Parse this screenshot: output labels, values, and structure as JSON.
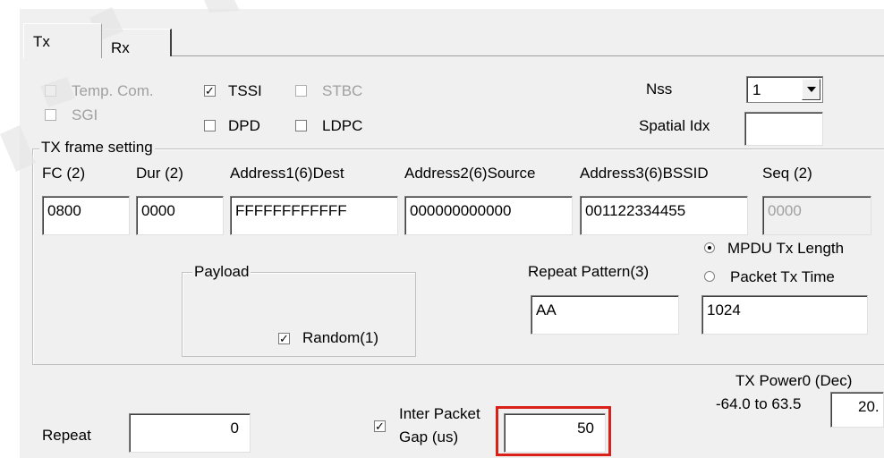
{
  "tabs": [
    {
      "label": "Tx",
      "active": true
    },
    {
      "label": "Rx",
      "active": false
    }
  ],
  "options": {
    "temp_com": {
      "label": "Temp. Com.",
      "checked": false,
      "enabled": false
    },
    "sgi": {
      "label": "SGI",
      "checked": false,
      "enabled": false
    },
    "tssi": {
      "label": "TSSI",
      "checked": true,
      "enabled": true
    },
    "dpd": {
      "label": "DPD",
      "checked": false,
      "enabled": true
    },
    "stbc": {
      "label": "STBC",
      "checked": false,
      "enabled": false
    },
    "ldpc": {
      "label": "LDPC",
      "checked": false,
      "enabled": true
    }
  },
  "nss": {
    "label": "Nss",
    "value": "1"
  },
  "spatial_idx": {
    "label": "Spatial Idx",
    "value": ""
  },
  "tx_frame": {
    "title": "TX frame setting",
    "fields": [
      {
        "label": "FC (2)",
        "value": "0800"
      },
      {
        "label": "Dur (2)",
        "value": "0000"
      },
      {
        "label": "Address1(6)Dest",
        "value": "FFFFFFFFFFFF"
      },
      {
        "label": "Address2(6)Source",
        "value": "000000000000"
      },
      {
        "label": "Address3(6)BSSID",
        "value": "001122334455"
      },
      {
        "label": "Seq (2)",
        "value": "0000"
      }
    ],
    "payload": {
      "title": "Payload",
      "random_label": "Random(1)",
      "random_checked": true
    },
    "repeat_pattern": {
      "label": "Repeat Pattern(3)",
      "value": "AA"
    },
    "length_mode": {
      "mpdu_label": "MPDU Tx Length",
      "packet_label": "Packet Tx Time",
      "selected": "mpdu",
      "value": "1024"
    }
  },
  "repeat": {
    "label": "Repeat",
    "value": "0"
  },
  "inter_packet_gap": {
    "label_line1": "Inter Packet",
    "label_line2": "Gap (us)",
    "checked": true,
    "value": "50"
  },
  "tx_power": {
    "label": "TX Power0 (Dec)",
    "range": "-64.0 to 63.5",
    "value": "20."
  },
  "colors": {
    "highlight": "#d9211a",
    "panel": "#f0f0f0"
  }
}
